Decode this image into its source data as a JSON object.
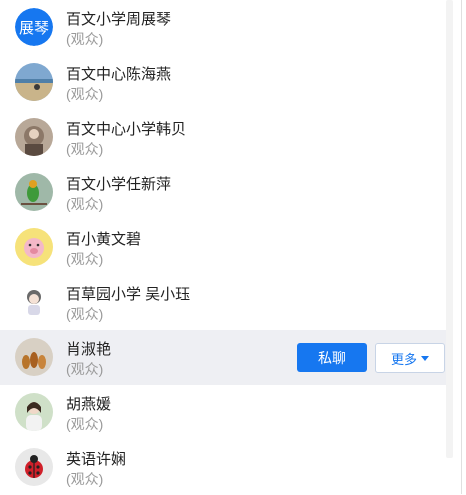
{
  "members": [
    {
      "avatar_text": "展琴",
      "avatar_kind": "text",
      "name": "百文小学周展琴",
      "role": "(观众)"
    },
    {
      "avatar_kind": "photo-beach",
      "name": "百文中心陈海燕",
      "role": "(观众)"
    },
    {
      "avatar_kind": "photo-mirror",
      "name": "百文中心小学韩贝",
      "role": "(观众)"
    },
    {
      "avatar_kind": "photo-parrot",
      "name": "百文小学任新萍",
      "role": "(观众)"
    },
    {
      "avatar_kind": "cartoon-pig",
      "name": "百小黄文碧",
      "role": "(观众)"
    },
    {
      "avatar_kind": "cartoon-girl",
      "name": "百草园小学 吴小珏",
      "role": "(观众)"
    },
    {
      "avatar_kind": "photo-dolls",
      "name": "肖淑艳",
      "role": "(观众)",
      "hovered": true,
      "chat_label": "私聊",
      "more_label": "更多"
    },
    {
      "avatar_kind": "photo-woman",
      "name": "胡燕媛",
      "role": "(观众)"
    },
    {
      "avatar_kind": "ladybug",
      "name": "英语许娴",
      "role": "(观众)"
    }
  ],
  "colors": {
    "accent": "#1677f0",
    "hover_row": "#eeeff3",
    "role_text": "#9a9a9a"
  }
}
